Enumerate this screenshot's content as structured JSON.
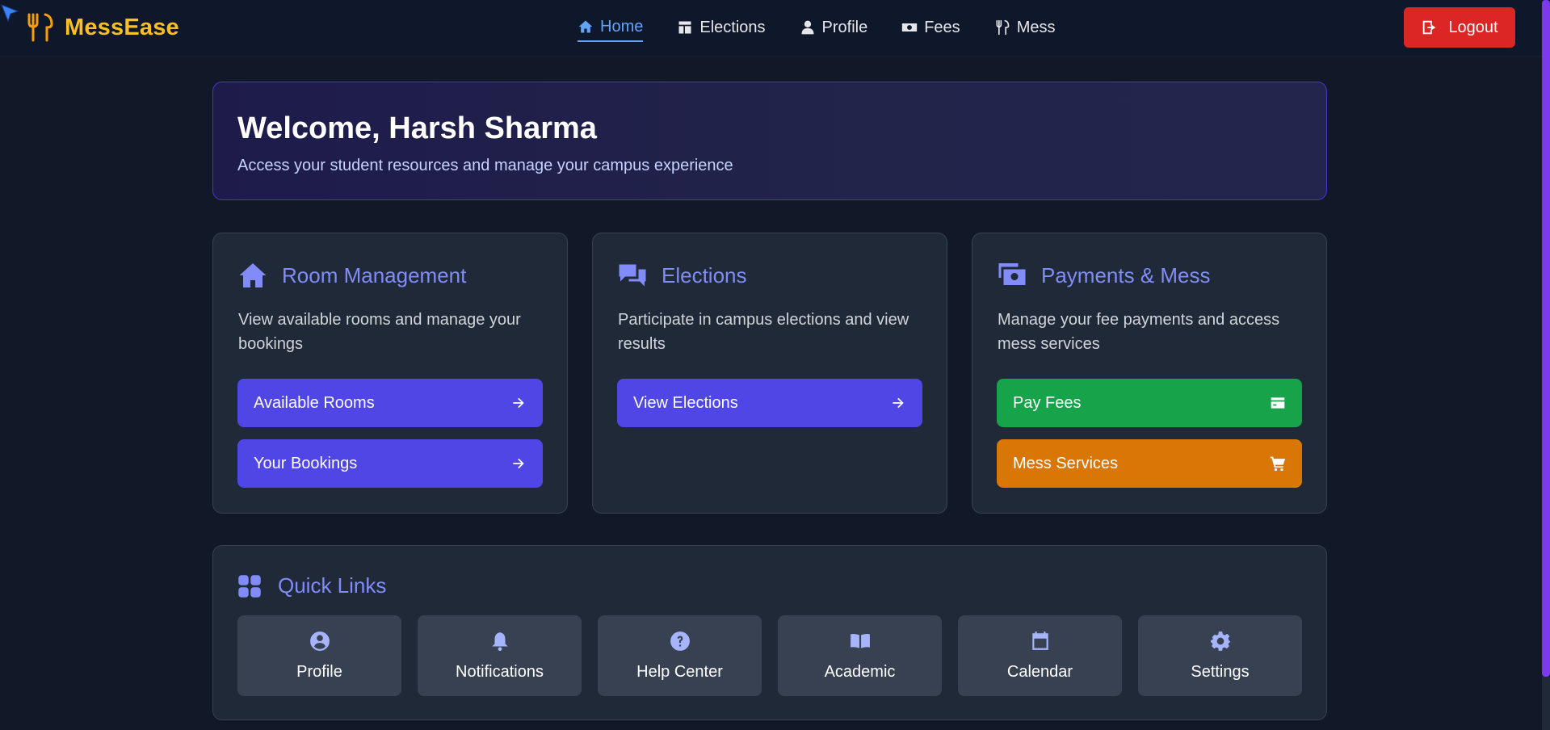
{
  "brand": {
    "name": "MessEase",
    "color": "#fbbf24",
    "icon": "utensils-icon"
  },
  "nav": {
    "links": [
      {
        "label": "Home",
        "icon": "home-icon",
        "active": true
      },
      {
        "label": "Elections",
        "icon": "ballot-icon",
        "active": false
      },
      {
        "label": "Profile",
        "icon": "user-icon",
        "active": false
      },
      {
        "label": "Fees",
        "icon": "money-icon",
        "active": false
      },
      {
        "label": "Mess",
        "icon": "utensils-icon",
        "active": false
      }
    ],
    "logout_label": "Logout"
  },
  "welcome": {
    "title": "Welcome, Harsh Sharma",
    "subtitle": "Access your student resources and manage your campus experience"
  },
  "cards": [
    {
      "title": "Room Management",
      "icon": "home-icon",
      "description": "View available rooms and manage your bookings",
      "buttons": [
        {
          "label": "Available Rooms",
          "icon": "arrow-right-icon",
          "color": "#4f46e5"
        },
        {
          "label": "Your Bookings",
          "icon": "arrow-right-icon",
          "color": "#4f46e5"
        }
      ]
    },
    {
      "title": "Elections",
      "icon": "comments-icon",
      "description": "Participate in campus elections and view results",
      "buttons": [
        {
          "label": "View Elections",
          "icon": "arrow-right-icon",
          "color": "#4f46e5"
        }
      ]
    },
    {
      "title": "Payments & Mess",
      "icon": "money-bills-icon",
      "description": "Manage your fee payments and access mess services",
      "buttons": [
        {
          "label": "Pay Fees",
          "icon": "credit-card-icon",
          "color": "#16a34a"
        },
        {
          "label": "Mess Services",
          "icon": "cart-icon",
          "color": "#d97706"
        }
      ]
    }
  ],
  "quick_links": {
    "title": "Quick Links",
    "icon": "grid-icon",
    "items": [
      {
        "label": "Profile",
        "icon": "user-circle-icon"
      },
      {
        "label": "Notifications",
        "icon": "bell-icon"
      },
      {
        "label": "Help Center",
        "icon": "question-circle-icon"
      },
      {
        "label": "Academic",
        "icon": "book-icon"
      },
      {
        "label": "Calendar",
        "icon": "calendar-icon"
      },
      {
        "label": "Settings",
        "icon": "gear-icon"
      }
    ]
  },
  "colors": {
    "accent": "#818cf8",
    "active_nav": "#60a5fa",
    "logout": "#dc2626"
  }
}
